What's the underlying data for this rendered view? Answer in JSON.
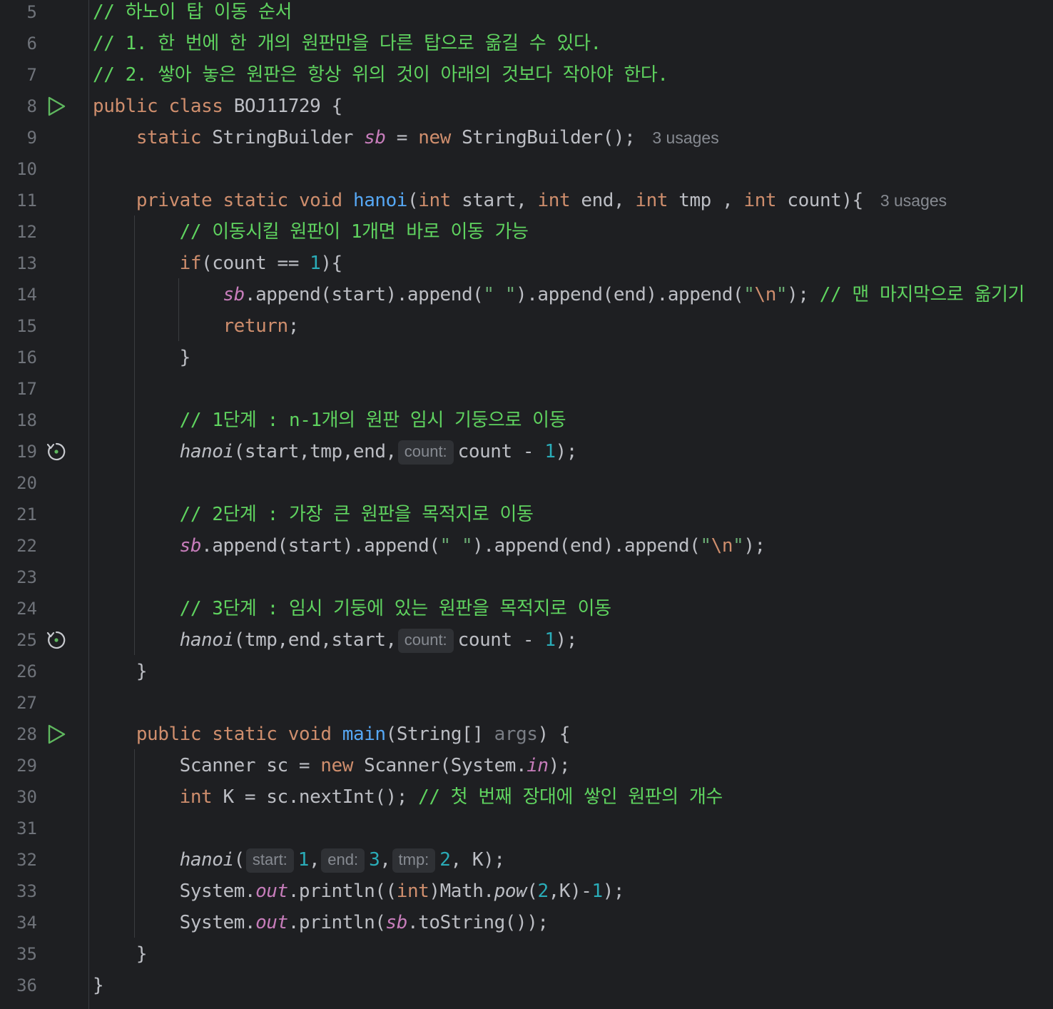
{
  "editor": {
    "usages_label": "3 usages",
    "lines": [
      {
        "num": "5",
        "comment": "// 하노이 탑 이동 순서"
      },
      {
        "num": "6",
        "comment": "// 1. 한 번에 한 개의 원판만을 다른 탑으로 옮길 수 있다."
      },
      {
        "num": "7",
        "comment": "// 2. 쌓아 놓은 원판은 항상 위의 것이 아래의 것보다 작아야 한다."
      },
      {
        "num": "8",
        "icon": "run-icon",
        "parts": {
          "k1": "public",
          "k2": "class",
          "name": "BOJ11729",
          "open": "{"
        }
      },
      {
        "num": "9",
        "parts": {
          "k1": "static",
          "type": "StringBuilder",
          "field": "sb",
          "eq": "=",
          "k2": "new",
          "call": "StringBuilder();"
        }
      },
      {
        "num": "10"
      },
      {
        "num": "11",
        "parts": {
          "k1": "private",
          "k2": "static",
          "k3": "void",
          "fn": "hanoi",
          "p1": "int",
          "a1": "start",
          "p2": "int",
          "a2": "end",
          "p3": "int",
          "a3": "tmp",
          "p4": "int",
          "a4": "count"
        }
      },
      {
        "num": "12",
        "comment": "// 이동시킬 원판이 1개면 바로 이동 가능"
      },
      {
        "num": "13",
        "parts": {
          "kw": "if",
          "cond": "(count == ",
          "n": "1",
          "close": "){"
        }
      },
      {
        "num": "14",
        "parts": {
          "field": "sb",
          "c1": ".append(start).append(",
          "s1": "\" \"",
          "c2": ").append(end).append(",
          "q1": "\"",
          "esc": "\\n",
          "q2": "\"",
          "c3": ");",
          "comment": "// 맨 마지막으로 옮기기"
        }
      },
      {
        "num": "15",
        "parts": {
          "kw": "return",
          "semi": ";"
        }
      },
      {
        "num": "16",
        "text": "}"
      },
      {
        "num": "17"
      },
      {
        "num": "18",
        "comment": "// 1단계 : n-1개의 원판 임시 기둥으로 이동"
      },
      {
        "num": "19",
        "icon": "recursive-call-icon",
        "parts": {
          "fn": "hanoi",
          "args": "(start,tmp,end,",
          "hint": "count:",
          "rest": "count - ",
          "n": "1",
          "close": ");"
        }
      },
      {
        "num": "20"
      },
      {
        "num": "21",
        "comment": "// 2단계 : 가장 큰 원판을 목적지로 이동"
      },
      {
        "num": "22",
        "parts": {
          "field": "sb",
          "c1": ".append(start).append(",
          "s1": "\" \"",
          "c2": ").append(end).append(",
          "q1": "\"",
          "esc": "\\n",
          "q2": "\"",
          "c3": ");"
        }
      },
      {
        "num": "23"
      },
      {
        "num": "24",
        "comment": "// 3단계 : 임시 기둥에 있는 원판을 목적지로 이동"
      },
      {
        "num": "25",
        "icon": "recursive-call-icon",
        "parts": {
          "fn": "hanoi",
          "args": "(tmp,end,start,",
          "hint": "count:",
          "rest": "count - ",
          "n": "1",
          "close": ");"
        }
      },
      {
        "num": "26",
        "text": "}"
      },
      {
        "num": "27"
      },
      {
        "num": "28",
        "icon": "run-icon",
        "parts": {
          "k1": "public",
          "k2": "static",
          "k3": "void",
          "fn": "main",
          "p": "(String[] ",
          "args": "args",
          "close": ") {"
        }
      },
      {
        "num": "29",
        "parts": {
          "a": "Scanner sc = ",
          "kw": "new",
          "b": " Scanner(System.",
          "st": "in",
          "c": ");"
        }
      },
      {
        "num": "30",
        "parts": {
          "kw": "int",
          "a": " K = sc.nextInt(); ",
          "comment": "// 첫 번째 장대에 쌓인 원판의 개수"
        }
      },
      {
        "num": "31"
      },
      {
        "num": "32",
        "parts": {
          "fn": "hanoi",
          "open": "(",
          "h1": "start:",
          "n1": "1",
          "h2": "end:",
          "n2": "3",
          "h3": "tmp:",
          "n3": "2",
          "rest": ", K);"
        }
      },
      {
        "num": "33",
        "parts": {
          "a": "System.",
          "st": "out",
          "b": ".println((",
          "kw": "int",
          "c": ")Math.",
          "fn": "pow",
          "d": "(",
          "n1": "2",
          "e": ",K)-",
          "n2": "1",
          "f": ");"
        }
      },
      {
        "num": "34",
        "parts": {
          "a": "System.",
          "st": "out",
          "b": ".println(",
          "field": "sb",
          "c": ".toString());"
        }
      },
      {
        "num": "35",
        "text": "}"
      },
      {
        "num": "36",
        "text": "}"
      }
    ]
  },
  "colors": {
    "background": "#1e1f22",
    "comment": "#5fd35f",
    "keyword": "#cf8e6d",
    "function": "#56a8f5",
    "field": "#c77dbb",
    "number": "#2aacb8",
    "string": "#6aab73",
    "line_number": "#6f737a"
  }
}
